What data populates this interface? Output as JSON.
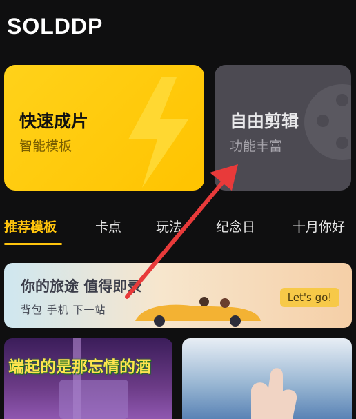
{
  "app": {
    "logo_text": "SOLDDP"
  },
  "feature_cards": [
    {
      "title": "快速成片",
      "subtitle": "智能模板"
    },
    {
      "title": "自由剪辑",
      "subtitle": "功能丰富"
    }
  ],
  "tabs": [
    {
      "label": "推荐模板",
      "active": true
    },
    {
      "label": "卡点"
    },
    {
      "label": "玩法"
    },
    {
      "label": "纪念日"
    },
    {
      "label": "十月你好"
    }
  ],
  "banner": {
    "title": "你的旅途 值得即录",
    "subtitle": "背包 手机 下一站",
    "button_label": "Let's go!"
  },
  "templates": [
    {
      "caption": "端起的是那忘情的酒"
    }
  ],
  "colors": {
    "accent": "#ffc40d",
    "arrow": "#e83a3a"
  }
}
